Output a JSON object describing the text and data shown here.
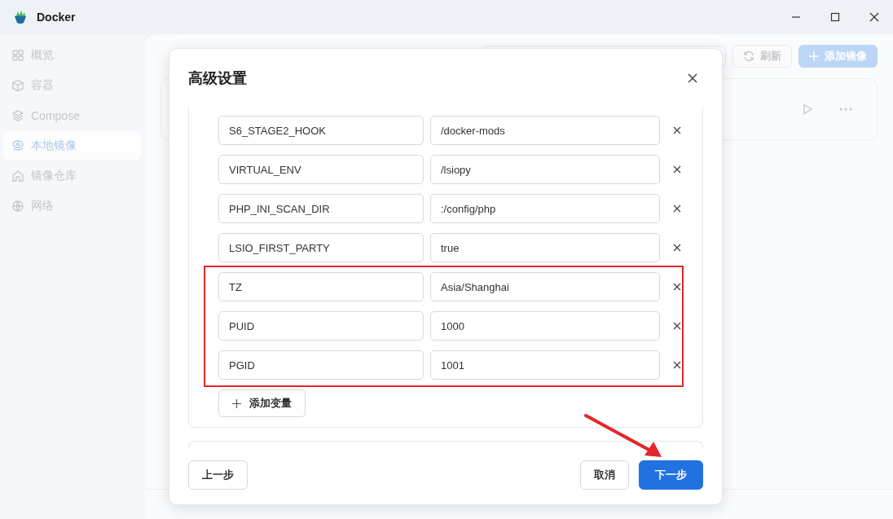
{
  "window": {
    "title": "Docker"
  },
  "sidebar": {
    "items": [
      {
        "label": "概览",
        "selected": false
      },
      {
        "label": "容器",
        "selected": false
      },
      {
        "label": "Compose",
        "selected": false
      },
      {
        "label": "本地镜像",
        "selected": true
      },
      {
        "label": "镜像仓库",
        "selected": false
      },
      {
        "label": "网络",
        "selected": false
      }
    ]
  },
  "page": {
    "refresh": "刷新",
    "add": "添加镜像"
  },
  "dialog": {
    "title": "高级设置",
    "env_vars": [
      {
        "name": "S6_STAGE2_HOOK",
        "value": "/docker-mods",
        "highlighted": false
      },
      {
        "name": "VIRTUAL_ENV",
        "value": "/lsiopy",
        "highlighted": false
      },
      {
        "name": "PHP_INI_SCAN_DIR",
        "value": ":/config/php",
        "highlighted": false
      },
      {
        "name": "LSIO_FIRST_PARTY",
        "value": "true",
        "highlighted": false
      },
      {
        "name": "TZ",
        "value": "Asia/Shanghai",
        "highlighted": true
      },
      {
        "name": "PUID",
        "value": "1000",
        "highlighted": true
      },
      {
        "name": "PGID",
        "value": "1001",
        "highlighted": true
      }
    ],
    "add_button": "添加变量",
    "back": "上一步",
    "cancel": "取消",
    "next": "下一步"
  }
}
